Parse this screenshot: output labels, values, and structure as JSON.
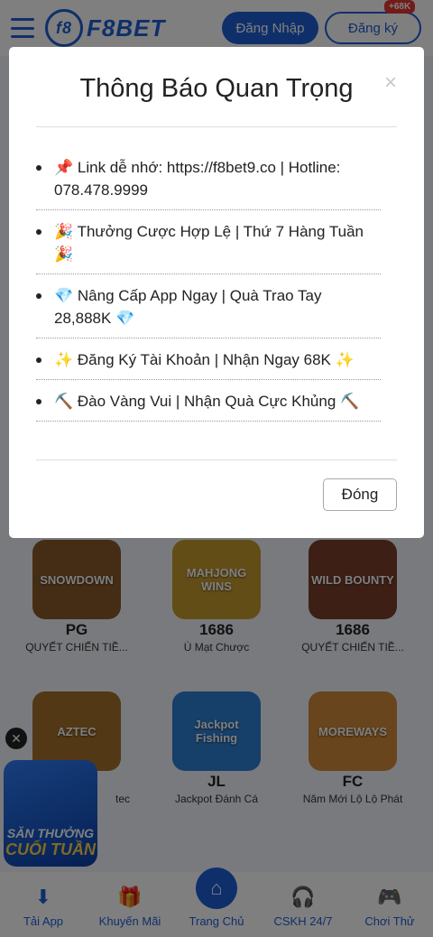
{
  "header": {
    "logo_text": "F8BET",
    "logo_badge": "f8",
    "login_label": "Đăng Nhập",
    "register_label": "Đăng ký",
    "register_badge": "+68K"
  },
  "games": [
    {
      "art": "SNOWDOWN",
      "provider": "PG",
      "name": "QUYẾT CHIẾN TIỀ...",
      "color": "#8a5a2b"
    },
    {
      "art": "MAHJONG WINS",
      "provider": "1686",
      "name": "Ù Mạt Chược",
      "color": "#c79b2f"
    },
    {
      "art": "WILD BOUNTY",
      "provider": "1686",
      "name": "QUYẾT CHIẾN TIỀ...",
      "color": "#7a3f2a"
    },
    {
      "art": "AZTEC",
      "provider": "",
      "name": "tec",
      "color": "#a5702a"
    },
    {
      "art": "Jackpot Fishing",
      "provider": "JL",
      "name": "Jackpot Đánh Cá",
      "color": "#2c7fd3"
    },
    {
      "art": "MOREWAYS",
      "provider": "FC",
      "name": "Năm Mới Lộ Lộ Phát",
      "color": "#d08a3a"
    }
  ],
  "promo": {
    "close_glyph": "✕",
    "line1": "SĂN THƯỞNG",
    "line2": "CUỐI TUẦN"
  },
  "bottom_nav": [
    {
      "icon": "⬇",
      "label": "Tải App"
    },
    {
      "icon": "🎁",
      "label": "Khuyến Mãi"
    },
    {
      "icon": "⌂",
      "label": "Trang Chủ"
    },
    {
      "icon": "🎧",
      "label": "CSKH 24/7"
    },
    {
      "icon": "🎮",
      "label": "Chơi Thử"
    }
  ],
  "modal": {
    "title": "Thông Báo Quan Trọng",
    "close_glyph": "×",
    "notices": [
      "📌 Link dễ nhớ: https://f8bet9.co | Hotline: 078.478.9999",
      "🎉 Thưởng Cược Hợp Lệ | Thứ 7 Hàng Tuần 🎉",
      "💎 Nâng Cấp App Ngay | Quà Trao Tay 28,888K 💎",
      "✨ Đăng Ký Tài Khoản | Nhận Ngay 68K ✨",
      "⛏️ Đào Vàng Vui | Nhận Quà Cực Khủng ⛏️"
    ],
    "button_label": "Đóng"
  },
  "colors": {
    "brand": "#1f5fd6",
    "overlay": "rgba(0,0,0,0.5)"
  }
}
